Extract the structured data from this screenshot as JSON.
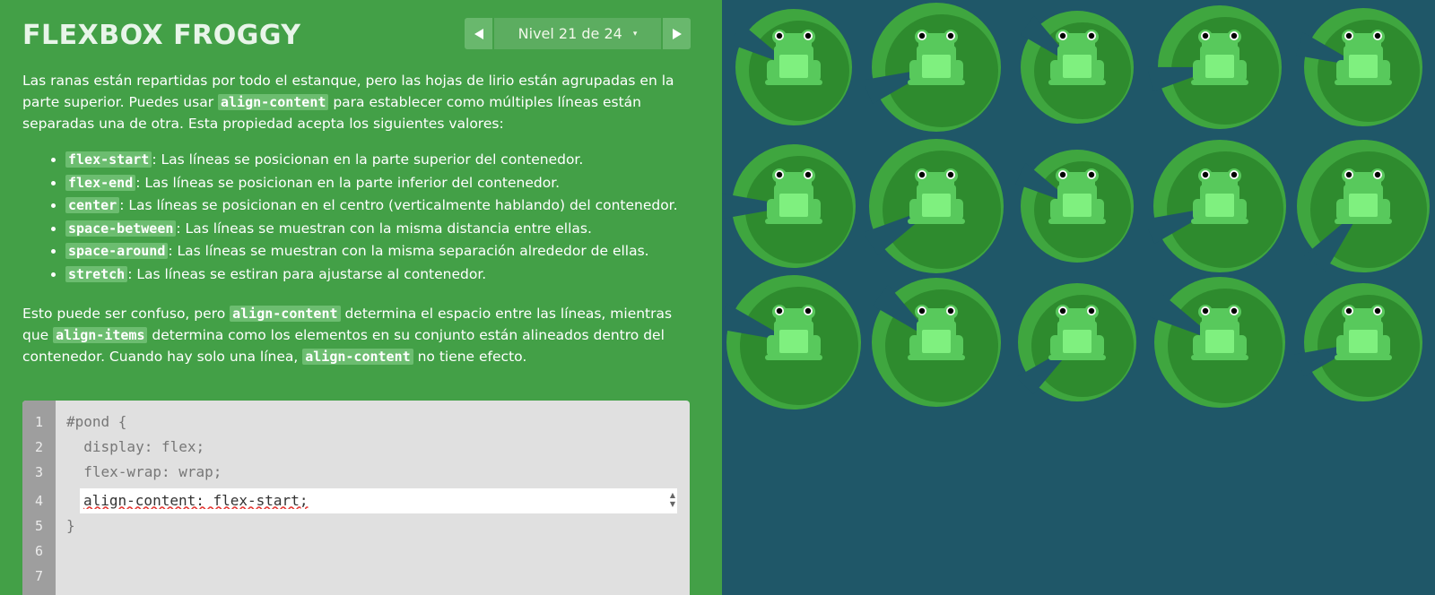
{
  "app": {
    "title": "FLEXBOX FROGGY"
  },
  "level_nav": {
    "prev_icon": "triangle-left",
    "next_icon": "triangle-right",
    "label": "Nivel 21 de 24",
    "caret": "▾"
  },
  "instructions": {
    "p1": {
      "t1": "Las ranas están repartidas por todo el estanque, pero las hojas de lirio están agrupadas en la parte superior. Puedes usar ",
      "c1": "align-content",
      "t2": " para establecer como múltiples líneas están separadas una de otra. Esta propiedad acepta los siguientes valores:"
    },
    "items": [
      {
        "code": "flex-start",
        "text": ": Las líneas se posicionan en la parte superior del contenedor."
      },
      {
        "code": "flex-end",
        "text": ": Las líneas se posicionan en la parte inferior del contenedor."
      },
      {
        "code": "center",
        "text": ": Las líneas se posicionan en el centro (verticalmente hablando) del contenedor."
      },
      {
        "code": "space-between",
        "text": ": Las líneas se muestran con la misma distancia entre ellas."
      },
      {
        "code": "space-around",
        "text": ": Las líneas se muestran con la misma separación alrededor de ellas."
      },
      {
        "code": "stretch",
        "text": ": Las líneas se estiran para ajustarse al contenedor."
      }
    ],
    "p2": {
      "t1": "Esto puede ser confuso, pero ",
      "c1": "align-content",
      "t2": " determina el espacio entre las líneas, mientras que ",
      "c2": "align-items",
      "t3": " determina como los elementos en su conjunto están alineados dentro del contenedor. Cuando hay solo una línea, ",
      "c3": "align-content",
      "t4": " no tiene efecto."
    }
  },
  "editor": {
    "line_numbers": [
      "1",
      "2",
      "3",
      "4",
      "5",
      "6",
      "7"
    ],
    "lines": [
      "#pond {",
      "  display: flex;",
      "  flex-wrap: wrap;",
      "",
      "}"
    ],
    "input_value": "align-content: flex-start;"
  },
  "pond": {
    "frog_count": 15,
    "colors": {
      "water": "#1f5768",
      "lilypad": "#2e8b2e",
      "lilypad_light": "#3fa63f",
      "frog_body": "#58c95c",
      "frog_belly": "#7ff07f",
      "sidebar": "#43a047"
    }
  }
}
